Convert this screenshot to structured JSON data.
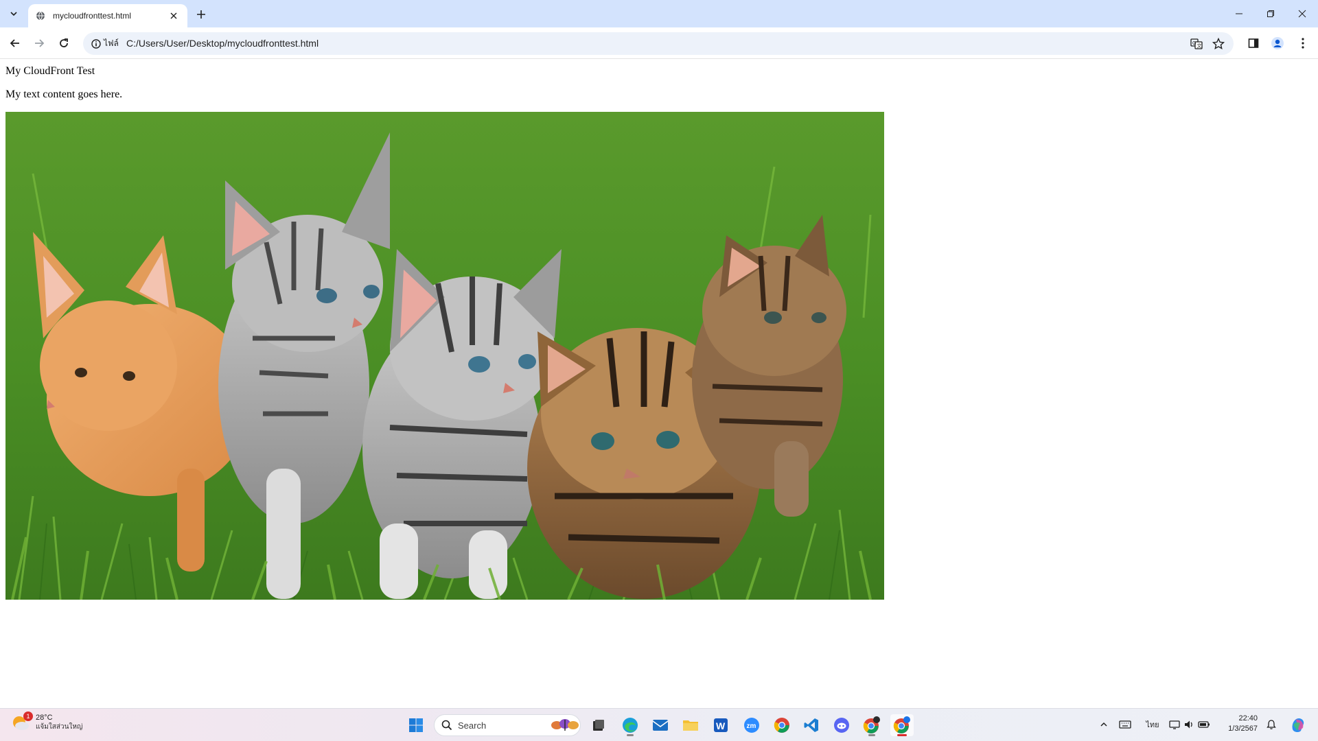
{
  "browser": {
    "tab_title": "mycloudfronttest.html",
    "address": "C:/Users/User/Desktop/mycloudfronttest.html",
    "site_info_label": "ไฟล์"
  },
  "page": {
    "title": "My CloudFront Test",
    "text": "My text content goes here.",
    "image_alt": "Five kittens sitting in green grass"
  },
  "taskbar": {
    "weather_temp": "28°C",
    "weather_condition": "แจ้มใสส่วนใหญ่",
    "weather_badge": "1",
    "search_placeholder": "Search",
    "language": "ไทย",
    "time": "22:40",
    "date": "1/3/2567",
    "apps": [
      "start-icon",
      "search-icon",
      "task-view-icon",
      "edge-icon",
      "mail-icon",
      "file-explorer-icon",
      "word-icon",
      "zoom-icon",
      "chrome-icon",
      "vscode-icon",
      "discord-icon",
      "chrome-profile-icon",
      "chrome-active-icon"
    ]
  },
  "colors": {
    "tabstrip": "#d3e3fd",
    "omnibox": "#edf2fa",
    "grass": "#4a8a2a"
  }
}
